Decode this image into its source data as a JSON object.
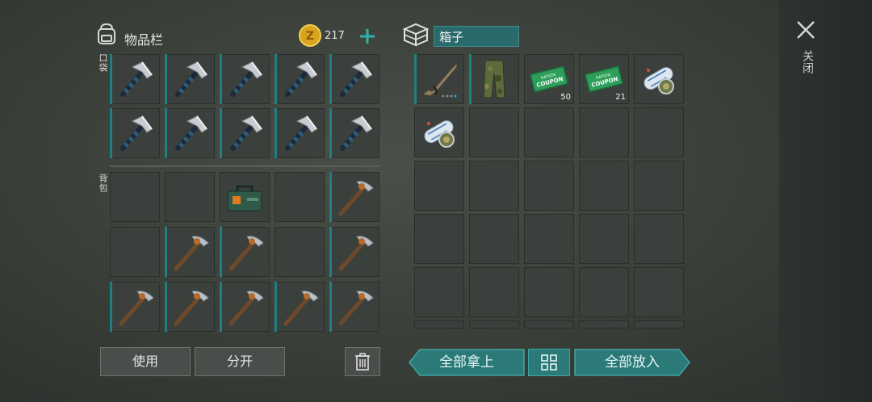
{
  "inventory": {
    "title": "物品栏",
    "coins": "217",
    "pocket_label": "口袋",
    "backpack_label": "背包",
    "pocket_slots": [
      {
        "item": "steel-axe"
      },
      {
        "item": "steel-axe"
      },
      {
        "item": "steel-axe"
      },
      {
        "item": "steel-axe"
      },
      {
        "item": "steel-axe"
      },
      {
        "item": "steel-axe"
      },
      {
        "item": "steel-axe"
      },
      {
        "item": "steel-axe"
      },
      {
        "item": "steel-axe"
      },
      {
        "item": "steel-axe"
      }
    ],
    "backpack_slots": [
      {
        "item": ""
      },
      {
        "item": ""
      },
      {
        "item": "ammo-box"
      },
      {
        "item": ""
      },
      {
        "item": "stone-pickaxe"
      },
      {
        "item": ""
      },
      {
        "item": "stone-pickaxe"
      },
      {
        "item": "stone-pickaxe"
      },
      {
        "item": ""
      },
      {
        "item": "stone-pickaxe"
      },
      {
        "item": "stone-pickaxe"
      },
      {
        "item": "stone-pickaxe"
      },
      {
        "item": "stone-pickaxe"
      },
      {
        "item": "stone-pickaxe"
      },
      {
        "item": "stone-pickaxe"
      }
    ],
    "use_label": "使用",
    "split_label": "分开"
  },
  "container": {
    "name": "箱子",
    "slots": [
      {
        "item": "assault-rifle",
        "count": ""
      },
      {
        "item": "camo-pants",
        "count": ""
      },
      {
        "item": "ration-coupon",
        "count": "50"
      },
      {
        "item": "ration-coupon",
        "count": "21"
      },
      {
        "item": "blueprint-roll",
        "count": ""
      },
      {
        "item": "blueprint-roll",
        "count": ""
      }
    ],
    "take_all_label": "全部拿上",
    "put_all_label": "全部放入",
    "coupon_text_1": "RATION",
    "coupon_text_2": "COUPON"
  },
  "close_label": "关闭",
  "colors": {
    "teal": "#1f7f82",
    "teal_button": "#2b7a78",
    "slot": "#3b403c"
  }
}
